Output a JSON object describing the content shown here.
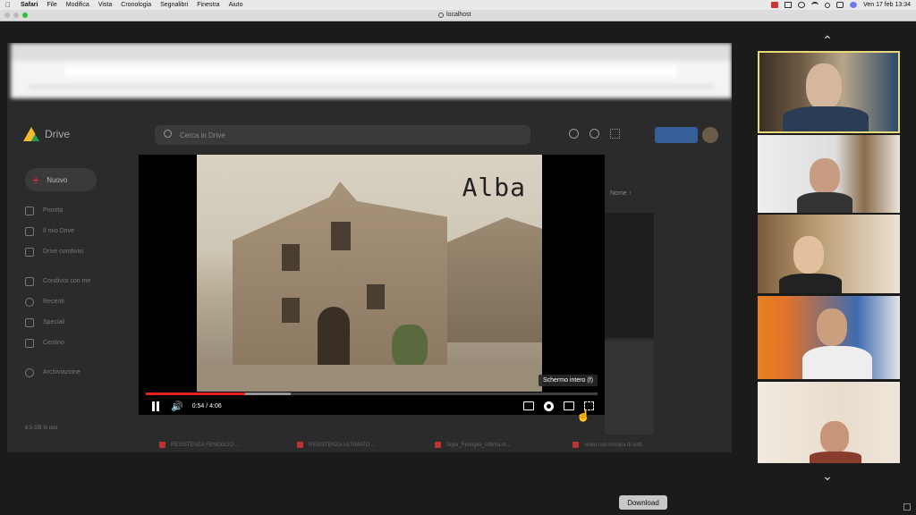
{
  "menubar": {
    "app": "Safari",
    "items": [
      "File",
      "Modifica",
      "Vista",
      "Cronologia",
      "Segnalibri",
      "Finestra",
      "Aiuto"
    ],
    "clock": "Ven 17 feb  13:34"
  },
  "browser": {
    "url": "localhost"
  },
  "drive": {
    "logo_text": "Drive",
    "search_placeholder": "Cerca in Drive",
    "new_label": "Nuovo",
    "nav": [
      "Priorità",
      "Il mio Drive",
      "Drive condivisi",
      "Condivisi con me",
      "Recenti",
      "Speciali",
      "Cestino",
      "Archiviazione"
    ],
    "storage": "6,5 GB in uso",
    "sort_label": "Nome",
    "files": [
      "RESISTENZA FENOGLIO ...",
      "RESISTENZA ULTIMATO ...",
      "Sigla_Fenoglio_Ultima.m...",
      "video con musica di soft..."
    ]
  },
  "video": {
    "caption": "Alba",
    "time": "0:54 / 4:06",
    "progress_played": 0.22,
    "progress_buffered": 0.32,
    "tooltip": "Schermo intero (f)"
  },
  "download_label": "Download"
}
